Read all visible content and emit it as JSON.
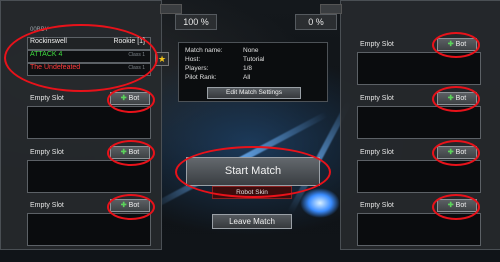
{
  "header": {
    "left_percent": "100 %",
    "right_percent": "0 %",
    "team_label": "00BBY"
  },
  "player": {
    "name": "Rockinswell",
    "rank": "Rookie [1]",
    "loadout": "ATTACK 4",
    "loadout_class": "Class 1",
    "title": "The Undefeated",
    "title_class": "Class 1"
  },
  "left_slots": [
    {
      "label": "Empty Slot",
      "bot_label": "Bot"
    },
    {
      "label": "Empty Slot",
      "bot_label": "Bot"
    },
    {
      "label": "Empty Slot",
      "bot_label": "Bot"
    }
  ],
  "right_slots": [
    {
      "label": "Empty Slot",
      "bot_label": "Bot"
    },
    {
      "label": "Empty Slot",
      "bot_label": "Bot"
    },
    {
      "label": "Empty Slot",
      "bot_label": "Bot"
    },
    {
      "label": "Empty Slot",
      "bot_label": "Bot"
    }
  ],
  "match_info": {
    "name_label": "Match name:",
    "name_value": "None",
    "host_label": "Host:",
    "host_value": "Tutorial",
    "players_label": "Players:",
    "players_value": "1/8",
    "rank_label": "Pilot Rank:",
    "rank_value": "All",
    "edit_button": "Edit Match Settings"
  },
  "actions": {
    "start_match": "Start Match",
    "robot_skin": "Robot Skin",
    "leave_match": "Leave Match"
  },
  "icons": {
    "favorite": "star-icon",
    "add": "plus-icon"
  },
  "colors": {
    "highlight_ring": "#e8121a",
    "loadout_text": "#3fdc3f",
    "title_text": "#ff3b3b",
    "star": "#f5c518"
  }
}
